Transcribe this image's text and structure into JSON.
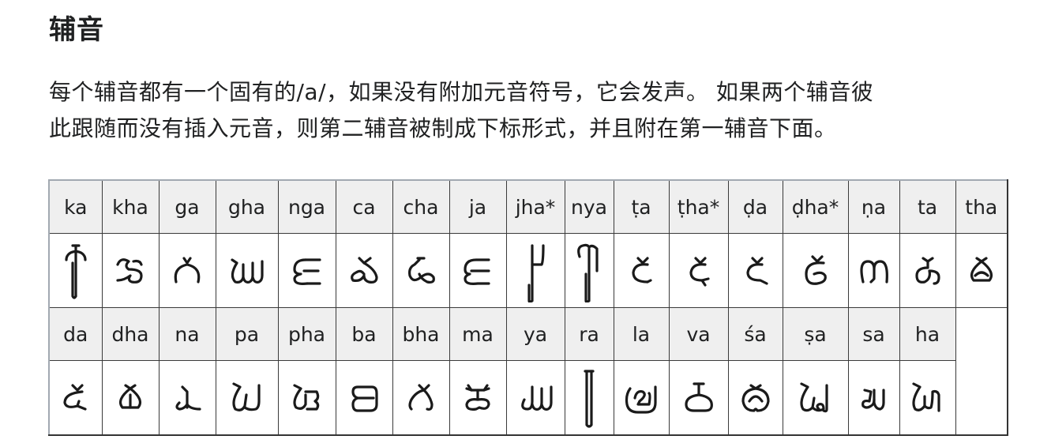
{
  "heading": "辅音",
  "paragraph": {
    "line1": "每个辅音都有一个固有的/a/，如果没有附加元音符号，它会发声。 如果两个辅音彼",
    "line2": "此跟随而没有插入元音，则第二辅音被制成下标形式，并且附在第一辅音下面。"
  },
  "consonant_table": {
    "row1": [
      {
        "label": "ka",
        "glyph": "ka-glyph"
      },
      {
        "label": "kha",
        "glyph": "kha-glyph"
      },
      {
        "label": "ga",
        "glyph": "ga-glyph"
      },
      {
        "label": "gha",
        "glyph": "gha-glyph"
      },
      {
        "label": "nga",
        "glyph": "nga-glyph"
      },
      {
        "label": "ca",
        "glyph": "ca-glyph"
      },
      {
        "label": "cha",
        "glyph": "cha-glyph"
      },
      {
        "label": "ja",
        "glyph": "ja-glyph"
      },
      {
        "label": "jha*",
        "glyph": "jha-glyph"
      },
      {
        "label": "nya",
        "glyph": "nya-glyph"
      },
      {
        "label": "ṭa",
        "glyph": "tta-glyph"
      },
      {
        "label": "ṭha*",
        "glyph": "ttha-glyph"
      },
      {
        "label": "ḍa",
        "glyph": "dda-glyph"
      },
      {
        "label": "ḍha*",
        "glyph": "ddha-glyph"
      },
      {
        "label": "ṇa",
        "glyph": "nna-glyph"
      },
      {
        "label": "ta",
        "glyph": "ta-glyph"
      },
      {
        "label": "tha",
        "glyph": "tha-glyph"
      }
    ],
    "row2": [
      {
        "label": "da",
        "glyph": "da-glyph"
      },
      {
        "label": "dha",
        "glyph": "dha-glyph"
      },
      {
        "label": "na",
        "glyph": "na-glyph"
      },
      {
        "label": "pa",
        "glyph": "pa-glyph"
      },
      {
        "label": "pha",
        "glyph": "pha-glyph"
      },
      {
        "label": "ba",
        "glyph": "ba-glyph"
      },
      {
        "label": "bha",
        "glyph": "bha-glyph"
      },
      {
        "label": "ma",
        "glyph": "ma-glyph"
      },
      {
        "label": "ya",
        "glyph": "ya-glyph"
      },
      {
        "label": "ra",
        "glyph": "ra-glyph"
      },
      {
        "label": "la",
        "glyph": "la-glyph"
      },
      {
        "label": "va",
        "glyph": "va-glyph"
      },
      {
        "label": "śa",
        "glyph": "sha-glyph"
      },
      {
        "label": "ṣa",
        "glyph": "ssa-glyph"
      },
      {
        "label": "sa",
        "glyph": "sa-glyph"
      },
      {
        "label": "ha",
        "glyph": "ha-glyph"
      }
    ]
  }
}
